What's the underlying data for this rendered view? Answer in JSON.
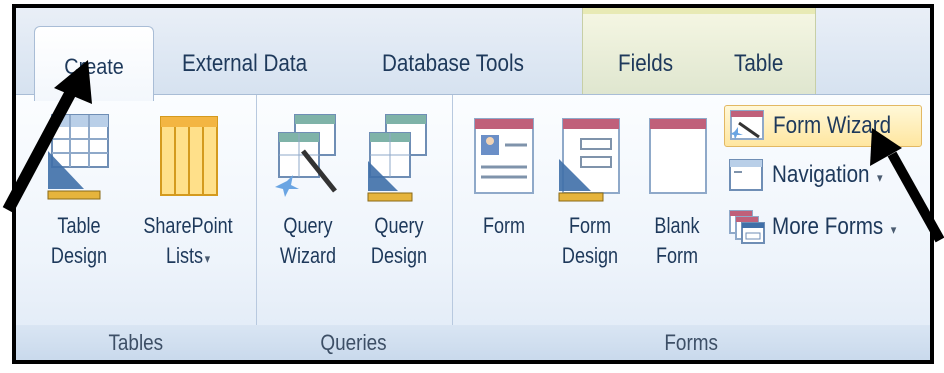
{
  "tabs": {
    "create": "Create",
    "external_data": "External Data",
    "database_tools": "Database Tools",
    "fields": "Fields",
    "table": "Table"
  },
  "groups": {
    "tables": {
      "label": "Tables",
      "table_design": [
        "Table",
        "Design"
      ],
      "sharepoint_lists": [
        "SharePoint",
        "Lists"
      ]
    },
    "queries": {
      "label": "Queries",
      "query_wizard": [
        "Query",
        "Wizard"
      ],
      "query_design": [
        "Query",
        "Design"
      ]
    },
    "forms": {
      "label": "Forms",
      "form": "Form",
      "form_design": [
        "Form",
        "Design"
      ],
      "blank_form": [
        "Blank",
        "Form"
      ],
      "form_wizard": "Form Wizard",
      "navigation": "Navigation",
      "more_forms": "More Forms"
    }
  },
  "dropdown_glyph": "▾",
  "colors": {
    "ribbon_text": "#1e395b",
    "highlight": "#ffe6a0",
    "arrow": "#000000"
  }
}
